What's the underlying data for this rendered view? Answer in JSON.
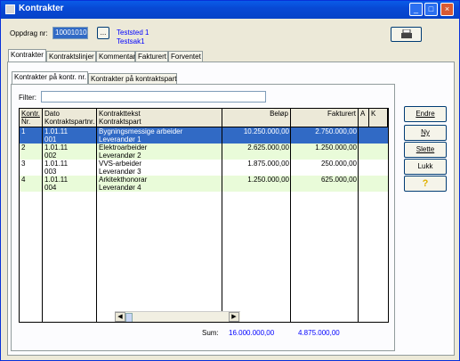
{
  "window": {
    "title": "Kontrakter"
  },
  "header": {
    "oppdrag_label": "Oppdrag nr:",
    "oppdrag_value": "10001010",
    "browse_label": "...",
    "teststed": "Teststed 1",
    "testsak": "Testsak1",
    "print_icon": "printer-icon"
  },
  "tabs": [
    "Kontrakter",
    "Kontraktslinjer",
    "Kommentar",
    "Fakturert",
    "Forventet"
  ],
  "subtabs": [
    "Kontrakter på kontr. nr.",
    "Kontrakter på kontraktspart"
  ],
  "filter": {
    "label": "Filter:",
    "value": ""
  },
  "table": {
    "headers": {
      "nr": [
        "Kontr.",
        "Nr."
      ],
      "dato": [
        "Dato",
        "Kontraktspartnr."
      ],
      "tekst": [
        "Kontrakttekst",
        "Kontraktspart"
      ],
      "belop": "Beløp",
      "fakturert": "Fakturert",
      "a": "A",
      "k": "K"
    },
    "rows": [
      {
        "nr": "1",
        "dato": "1.01.11",
        "partnr": "001",
        "tekst": "Bygningsmessige arbeider",
        "part": "Leverandør 1",
        "belop": "10.250.000,00",
        "fakturert": "2.750.000,00"
      },
      {
        "nr": "2",
        "dato": "1.01.11",
        "partnr": "002",
        "tekst": "Elektroarbeider",
        "part": "Leverandør 2",
        "belop": "2.625.000,00",
        "fakturert": "1.250.000,00"
      },
      {
        "nr": "3",
        "dato": "1.01.11",
        "partnr": "003",
        "tekst": "VVS-arbeider",
        "part": "Leverandør 3",
        "belop": "1.875.000,00",
        "fakturert": "250.000,00"
      },
      {
        "nr": "4",
        "dato": "1.01.11",
        "partnr": "004",
        "tekst": "Arkitekthonorar",
        "part": "Leverandør 4",
        "belop": "1.250.000,00",
        "fakturert": "625.000,00"
      }
    ]
  },
  "sum": {
    "label": "Sum:",
    "belop": "16.000.000,00",
    "fakturert": "4.875.000,00"
  },
  "buttons": {
    "endre": "Endre",
    "ny": "Ny",
    "slette": "Slette",
    "lukk": "Lukk",
    "help": "?"
  },
  "colors": {
    "selected": "#316ac5",
    "alt_row": "#e9fbd9",
    "sum_text": "#0000ff"
  }
}
